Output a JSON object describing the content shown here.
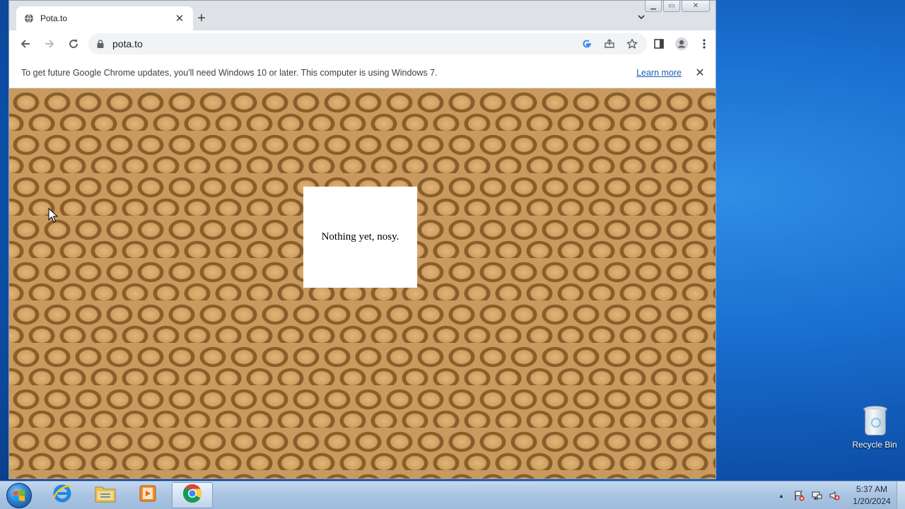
{
  "tab": {
    "title": "Pota.to",
    "close_glyph": "✕",
    "new_tab_glyph": "+",
    "search_glyph": "⌄"
  },
  "window_controls": {
    "minimize_glyph": "▁",
    "maximize_glyph": "▭",
    "close_glyph": "✕"
  },
  "toolbar": {
    "url": "pota.to"
  },
  "infobar": {
    "message": "To get future Google Chrome updates, you'll need Windows 10 or later. This computer is using Windows 7.",
    "link_label": "Learn more",
    "close_glyph": "✕"
  },
  "page": {
    "message": "Nothing yet, nosy."
  },
  "desktop": {
    "recycle_bin_label": "Recycle Bin"
  },
  "taskbar": {
    "items": [
      "start",
      "internet-explorer",
      "file-explorer",
      "media-player",
      "chrome"
    ],
    "active_item": "chrome"
  },
  "tray": {
    "up_arrow_glyph": "▲",
    "time": "5:37 AM",
    "date": "1/20/2024"
  },
  "colors": {
    "chrome_frame": "#dee1e6",
    "link": "#1a5fb4",
    "potato_light": "#e0b57a",
    "potato_dark": "#8a5d2c"
  }
}
